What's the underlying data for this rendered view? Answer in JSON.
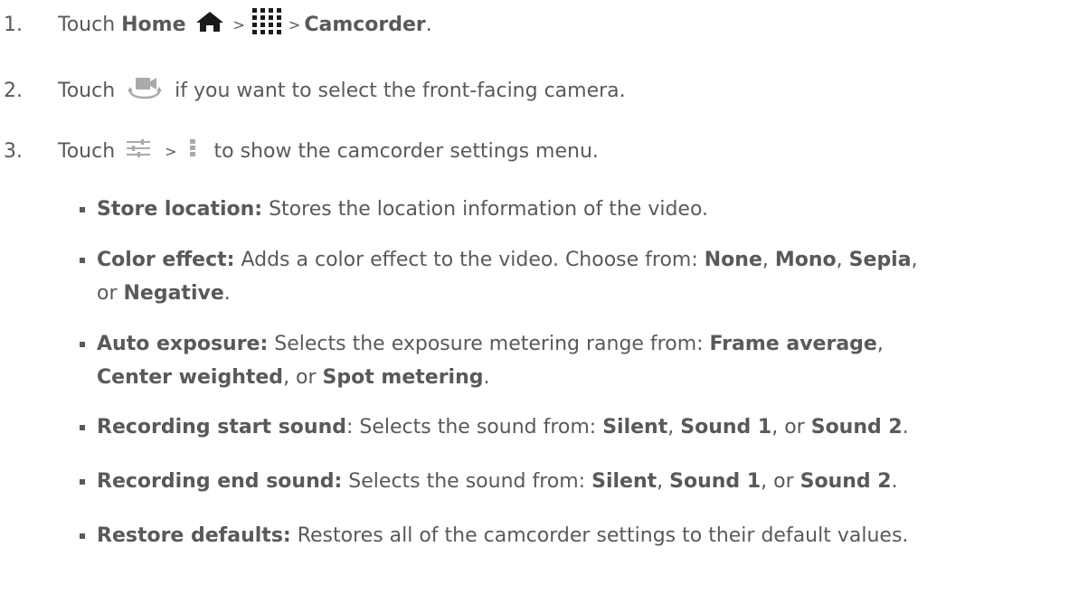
{
  "steps": [
    {
      "num": "1.",
      "a": "Touch ",
      "home": "Home",
      "gt1": ">",
      "gt2": ">",
      "cam": "Camcorder",
      "end": "."
    },
    {
      "num": "2.",
      "a": "Touch ",
      "b": " if you want to select the front-facing camera."
    },
    {
      "num": "3.",
      "a": "Touch ",
      "gt": ">",
      "b": " to show the camcorder settings menu."
    }
  ],
  "items": [
    {
      "label": "Store location:",
      "text": " Stores the location information of the video."
    },
    {
      "label": "Color effect:",
      "text": " Adds a color effect to the video. Choose from: ",
      "o1": "None",
      "s1": ", ",
      "o2": "Mono",
      "s2": ", ",
      "o3": "Sepia",
      "s3": ",",
      "line2a": "or ",
      "o4": "Negative",
      "end": "."
    },
    {
      "label": "Auto exposure:",
      "text": " Selects the exposure metering range from: ",
      "o1": "Frame average",
      "s1": ",",
      "o2": "Center weighted",
      "s2": ", or ",
      "o3": "Spot metering",
      "end": "."
    },
    {
      "label": "Recording start sound",
      "sep": ": Selects the sound from: ",
      "o1": "Silent",
      "s1": ", ",
      "o2": "Sound 1",
      "s2": ", or ",
      "o3": "Sound 2",
      "end": "."
    },
    {
      "label": "Recording end sound:",
      "text": " Selects the sound from: ",
      "o1": "Silent",
      "s1": ", ",
      "o2": "Sound 1",
      "s2": ", or ",
      "o3": "Sound 2",
      "end": "."
    },
    {
      "label": "Restore defaults:",
      "text": " Restores all of the camcorder settings to their default values."
    }
  ],
  "icons": [
    "home-icon",
    "apps-grid-icon",
    "switch-camera-icon",
    "settings-sliders-icon",
    "overflow-menu-icon"
  ],
  "colors": {
    "text": "#595959",
    "icon": "#1a1a1a",
    "icon_light": "#aaaaaa"
  }
}
